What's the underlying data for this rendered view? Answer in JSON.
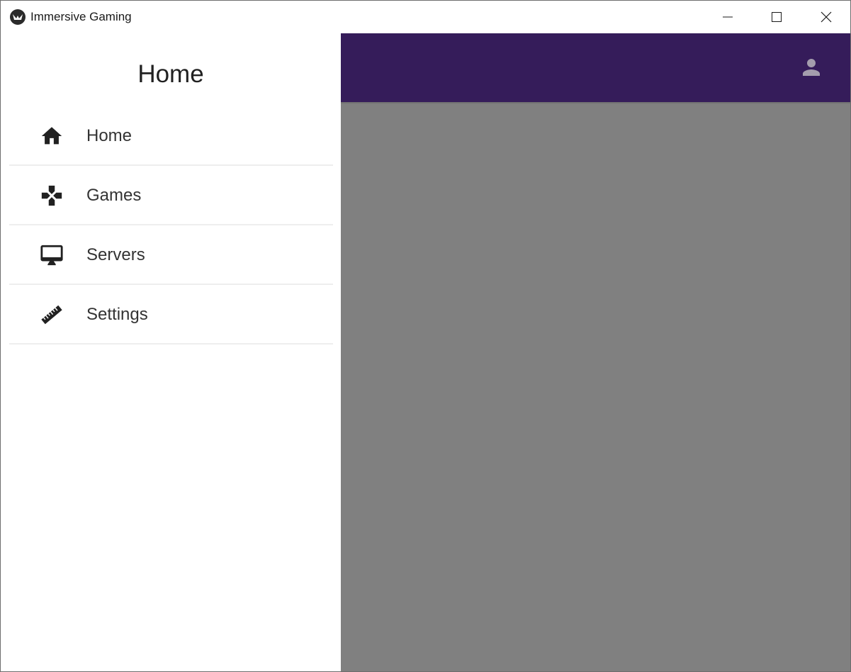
{
  "window": {
    "title": "Immersive Gaming",
    "controls": {
      "minimize": "minimize-icon",
      "maximize": "maximize-icon",
      "close": "close-icon"
    }
  },
  "drawer": {
    "title": "Home",
    "items": [
      {
        "label": "Home",
        "icon": "home-icon"
      },
      {
        "label": "Games",
        "icon": "gamepad-icon"
      },
      {
        "label": "Servers",
        "icon": "monitor-icon"
      },
      {
        "label": "Settings",
        "icon": "ruler-icon"
      }
    ]
  },
  "toolbar": {
    "account_icon": "account-icon"
  },
  "colors": {
    "toolbar": "#351c5a",
    "scrim": "#808080",
    "drawer_bg": "#ffffff",
    "divider": "#eeeeee",
    "account_icon": "#a49dad"
  }
}
